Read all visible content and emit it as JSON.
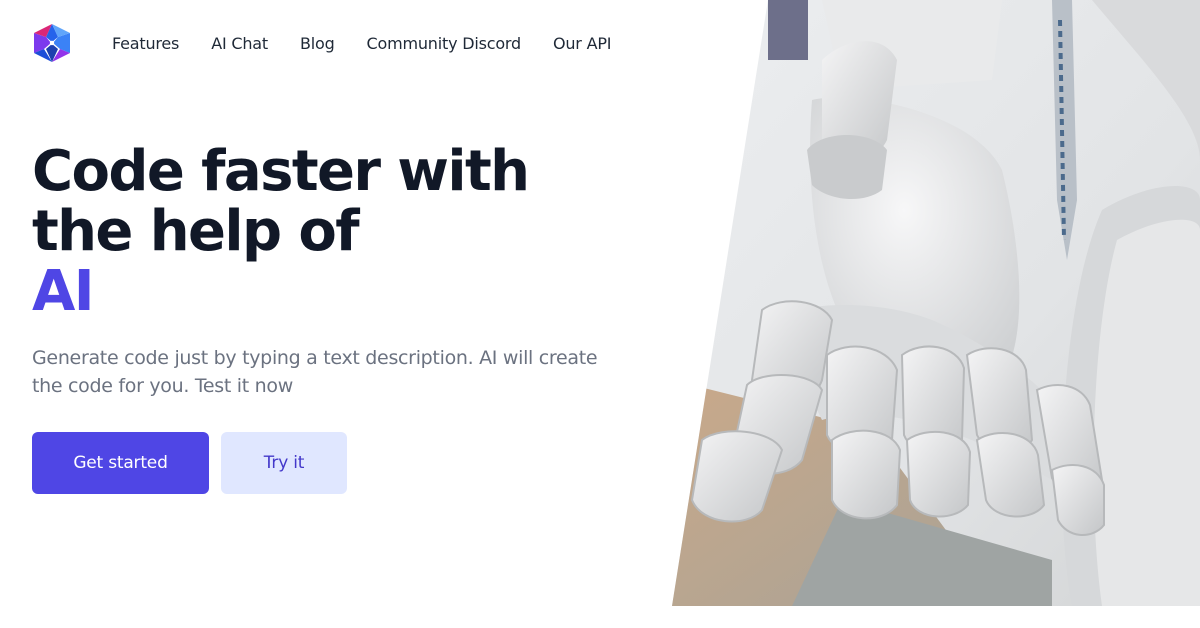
{
  "brand": {
    "logo_icon": "cube-star-logo-icon",
    "colors": [
      "#7c3aed",
      "#2563eb",
      "#db2777",
      "#1e40af"
    ]
  },
  "nav": {
    "items": [
      {
        "label": "Features"
      },
      {
        "label": "AI Chat"
      },
      {
        "label": "Blog"
      },
      {
        "label": "Community Discord"
      },
      {
        "label": "Our API"
      }
    ]
  },
  "hero": {
    "headline": "Code faster with the help of",
    "headline_accent": "AI",
    "subtitle": "Generate code just by typing a text description. AI will create the code for you. Test it now",
    "primary_button": "Get started",
    "secondary_button": "Try it",
    "image": "robot-hand-photo"
  },
  "colors": {
    "accent": "#4f46e5",
    "accent_light": "#e0e7ff",
    "text": "#111827",
    "muted": "#6b7280"
  }
}
